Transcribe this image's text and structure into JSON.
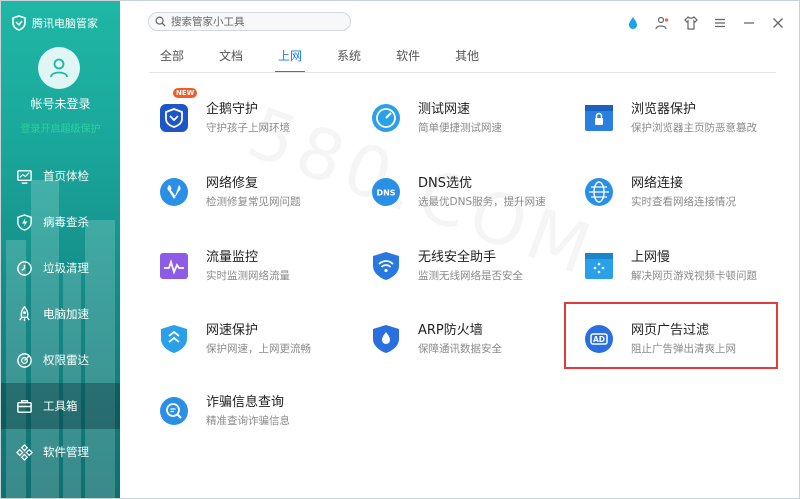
{
  "brand": {
    "title": "腾讯电脑管家"
  },
  "account": {
    "name": "帐号未登录",
    "subtitle": "登录开启超级保护"
  },
  "nav": [
    {
      "label": "首页体检",
      "icon": "monitor-icon"
    },
    {
      "label": "病毒查杀",
      "icon": "shield-bolt-icon"
    },
    {
      "label": "垃圾清理",
      "icon": "broom-icon"
    },
    {
      "label": "电脑加速",
      "icon": "rocket-icon"
    },
    {
      "label": "权限雷达",
      "icon": "radar-icon"
    },
    {
      "label": "工具箱",
      "icon": "toolbox-icon"
    },
    {
      "label": "软件管理",
      "icon": "apps-icon"
    }
  ],
  "search": {
    "placeholder": "搜索管家小工具"
  },
  "tabs": [
    "全部",
    "文档",
    "上网",
    "系统",
    "软件",
    "其他"
  ],
  "active_tab": "上网",
  "tools": [
    {
      "title": "企鹅守护",
      "desc": "守护孩子上网环境",
      "badge": "NEW",
      "color": "#1e56c8"
    },
    {
      "title": "测试网速",
      "desc": "简单便捷测试网速",
      "color": "#2aa0e8"
    },
    {
      "title": "浏览器保护",
      "desc": "保护浏览器主页防恶意篡改",
      "color": "#2b7fe0"
    },
    {
      "title": "网络修复",
      "desc": "检测修复常见网问题",
      "color": "#2a8fe6"
    },
    {
      "title": "DNS选优",
      "desc": "选最优DNS服务，提升网速",
      "color": "#2a8fe6"
    },
    {
      "title": "网络连接",
      "desc": "实时查看网络连接情况",
      "color": "#2a8fe6"
    },
    {
      "title": "流量监控",
      "desc": "实时监测网络流量",
      "color": "#8d5be6"
    },
    {
      "title": "无线安全助手",
      "desc": "监测无线网络是否安全",
      "color": "#2878e0"
    },
    {
      "title": "上网慢",
      "desc": "解决网页游戏视频卡顿问题",
      "color": "#2aa0e8"
    },
    {
      "title": "网速保护",
      "desc": "保护网速，上网更流畅",
      "color": "#2aa0e8"
    },
    {
      "title": "ARP防火墙",
      "desc": "保障通讯数据安全",
      "color": "#2a6fe0"
    },
    {
      "title": "网页广告过滤",
      "desc": "阻止广告弹出清爽上网",
      "color": "#2a6fe0"
    },
    {
      "title": "诈骗信息查询",
      "desc": "精准查询诈骗信息",
      "color": "#2a8fe6"
    }
  ]
}
